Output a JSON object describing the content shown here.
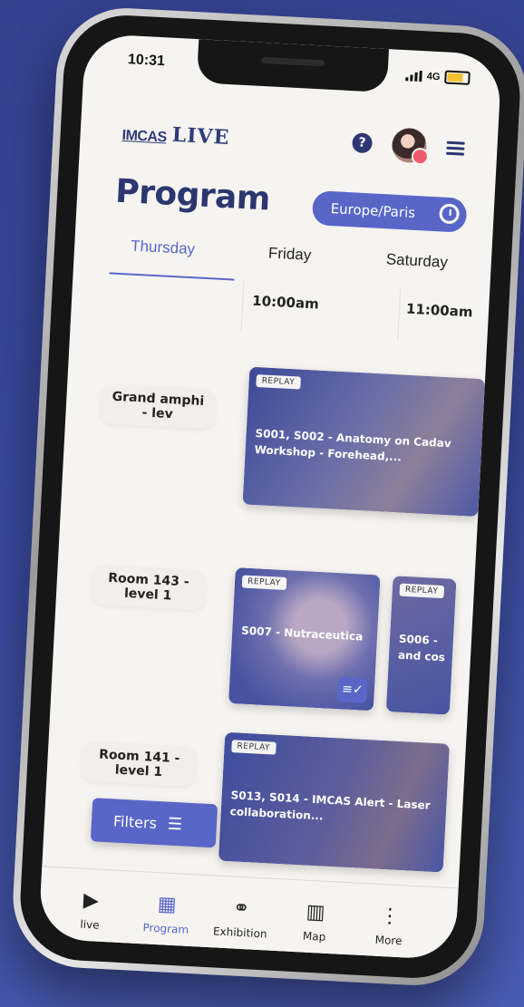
{
  "status": {
    "time": "10:31",
    "network": "4G"
  },
  "header": {
    "logo_main": "IMCAS",
    "logo_live": "LIVE",
    "help_icon": "question-icon",
    "menu_icon": "list-icon"
  },
  "page": {
    "title": "Program",
    "timezone": "Europe/Paris"
  },
  "days": [
    {
      "label": "Thursday",
      "active": true
    },
    {
      "label": "Friday",
      "active": false
    },
    {
      "label": "Saturday",
      "active": false
    }
  ],
  "times": [
    "10:00am",
    "11:00am"
  ],
  "rooms": [
    "Grand amphi - lev",
    "Room 143 - level 1",
    "Room 141 - level 1"
  ],
  "sessions": [
    {
      "badge": "REPLAY",
      "title": "S001, S002 - Anatomy on Cadav Workshop - Forehead,..."
    },
    {
      "badge": "REPLAY",
      "title": "S007 - Nutraceutica"
    },
    {
      "badge": "REPLAY",
      "title": "S006 - and cos"
    },
    {
      "badge": "REPLAY",
      "title": "S013, S014 - IMCAS Alert - Laser collaboration..."
    }
  ],
  "filters": {
    "label": "Filters"
  },
  "tabs": [
    {
      "label": "live",
      "icon": "play-icon"
    },
    {
      "label": "Program",
      "icon": "calendar-icon"
    },
    {
      "label": "Exhibition",
      "icon": "handshake-icon"
    },
    {
      "label": "Map",
      "icon": "map-icon"
    },
    {
      "label": "More",
      "icon": "more-icon"
    }
  ],
  "colors": {
    "accent": "#5966c8",
    "title": "#2c3770",
    "background": "#3b4aa0"
  }
}
